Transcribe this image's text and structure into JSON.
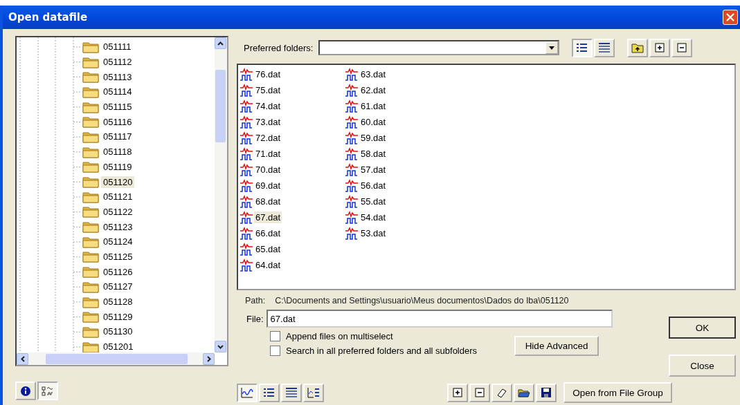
{
  "window": {
    "title": "Open datafile"
  },
  "folders": [
    {
      "name": "051111",
      "selected": false
    },
    {
      "name": "051112",
      "selected": false
    },
    {
      "name": "051113",
      "selected": false
    },
    {
      "name": "051114",
      "selected": false
    },
    {
      "name": "051115",
      "selected": false
    },
    {
      "name": "051116",
      "selected": false
    },
    {
      "name": "051117",
      "selected": false
    },
    {
      "name": "051118",
      "selected": false
    },
    {
      "name": "051119",
      "selected": false
    },
    {
      "name": "051120",
      "selected": true
    },
    {
      "name": "051121",
      "selected": false
    },
    {
      "name": "051122",
      "selected": false
    },
    {
      "name": "051123",
      "selected": false
    },
    {
      "name": "051124",
      "selected": false
    },
    {
      "name": "051125",
      "selected": false
    },
    {
      "name": "051126",
      "selected": false
    },
    {
      "name": "051127",
      "selected": false
    },
    {
      "name": "051128",
      "selected": false
    },
    {
      "name": "051129",
      "selected": false
    },
    {
      "name": "051130",
      "selected": false
    },
    {
      "name": "051201",
      "selected": false
    }
  ],
  "preferred_folders": {
    "label": "Preferred folders:"
  },
  "view_buttons": [
    {
      "kind": "list",
      "selected": true
    },
    {
      "kind": "grid",
      "selected": false
    }
  ],
  "folder_buttons": [
    {
      "kind": "up"
    },
    {
      "kind": "add"
    },
    {
      "kind": "remove"
    }
  ],
  "files": [
    {
      "name": "76.dat",
      "selected": false
    },
    {
      "name": "75.dat",
      "selected": false
    },
    {
      "name": "74.dat",
      "selected": false
    },
    {
      "name": "73.dat",
      "selected": false
    },
    {
      "name": "72.dat",
      "selected": false
    },
    {
      "name": "71.dat",
      "selected": false
    },
    {
      "name": "70.dat",
      "selected": false
    },
    {
      "name": "69.dat",
      "selected": false
    },
    {
      "name": "68.dat",
      "selected": false
    },
    {
      "name": "67.dat",
      "selected": true
    },
    {
      "name": "66.dat",
      "selected": false
    },
    {
      "name": "65.dat",
      "selected": false
    },
    {
      "name": "64.dat",
      "selected": false
    },
    {
      "name": "63.dat",
      "selected": false
    },
    {
      "name": "62.dat",
      "selected": false
    },
    {
      "name": "61.dat",
      "selected": false
    },
    {
      "name": "60.dat",
      "selected": false
    },
    {
      "name": "59.dat",
      "selected": false
    },
    {
      "name": "58.dat",
      "selected": false
    },
    {
      "name": "57.dat",
      "selected": false
    },
    {
      "name": "56.dat",
      "selected": false
    },
    {
      "name": "55.dat",
      "selected": false
    },
    {
      "name": "54.dat",
      "selected": false
    },
    {
      "name": "53.dat",
      "selected": false
    }
  ],
  "path": {
    "label": "Path:",
    "value": "C:\\Documents and Settings\\usuario\\Meus documentos\\Dados do Iba\\051120"
  },
  "file": {
    "label": "File:",
    "value": "67.dat"
  },
  "options": [
    {
      "label": "Append files on multiselect",
      "checked": false
    },
    {
      "label": "Search in all preferred folders and all subfolders",
      "checked": false
    }
  ],
  "buttons": {
    "ok": "OK",
    "close": "Close",
    "hide_advanced": "Hide Advanced",
    "open_group": "Open from File Group"
  },
  "panel_toggles": [
    {
      "kind": "info",
      "selected": false
    },
    {
      "kind": "signals",
      "selected": true
    }
  ],
  "view_modes": [
    {
      "kind": "graph",
      "selected": true
    },
    {
      "kind": "list",
      "selected": false
    },
    {
      "kind": "grid",
      "selected": false
    },
    {
      "kind": "graph_list",
      "selected": false
    }
  ],
  "file_actions": [
    {
      "kind": "add"
    },
    {
      "kind": "remove"
    },
    {
      "kind": "erase"
    },
    {
      "kind": "open"
    },
    {
      "kind": "save"
    }
  ]
}
